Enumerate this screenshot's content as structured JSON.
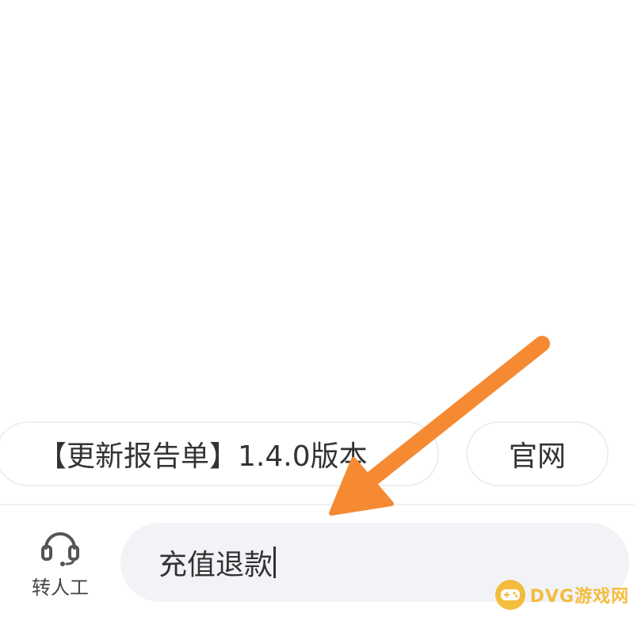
{
  "quick_replies": [
    {
      "label": "【更新报告单】1.4.0版本"
    },
    {
      "label": "官网"
    }
  ],
  "bottom_bar": {
    "agent_label": "转人工",
    "input_value": "充值退款"
  },
  "icons": {
    "agent": "headset-icon",
    "watermark_logo": "gamepad-icon"
  },
  "watermark": {
    "text": "DVG游戏网"
  },
  "colors": {
    "arrow": "#f58a33",
    "input_background": "#f1f3f7",
    "watermark": "#f5b82e"
  }
}
